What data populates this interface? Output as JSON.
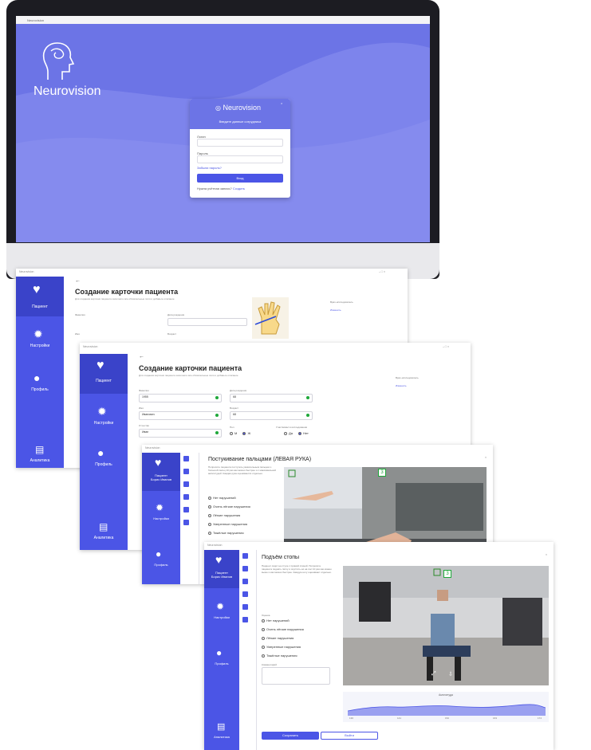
{
  "monitor": {
    "window_title": "Neurovision",
    "brand_name": "Neurovision",
    "login": {
      "logo_text": "Neurovision",
      "heading": "Введите данные сотрудника",
      "login_label": "Логин",
      "password_label": "Пароль",
      "forgot": "Забыли пароль?",
      "submit": "Вход",
      "register_prefix": "Нужна учётная запись?",
      "register_link": "Создать"
    }
  },
  "sidebar": {
    "patient": "Пациент",
    "settings": "Настройки",
    "profile": "Профиль",
    "analytics": "Аналитика"
  },
  "card": {
    "window_title": "Neurovision",
    "back": "←",
    "title": "Создание карточки пациента",
    "subtitle": "Для создания карточки пациента заполните все обязательные поля и добавьте описание",
    "surname_label": "Фамилия",
    "surname_value": "Петров",
    "birth_label": "Дата рождения",
    "birth_value": "1955",
    "name_label": "Имя",
    "name_value": "Иван",
    "age_label": "Возраст",
    "age_value": "68",
    "patronymic_label": "Отчество",
    "patronymic_value": "Иванович",
    "sex_label": "Пол",
    "sex_options": [
      "М",
      "Ж"
    ],
    "extra_label": "Участвовал в исследовании",
    "extra_options": [
      "Да",
      "Нет"
    ],
    "doctor_label": "Врач-исследователь",
    "doctor_value": "Сидоров",
    "change": "Изменить"
  },
  "fingers": {
    "window_title": "Neurovision",
    "title": "Постукивание пальцами (ЛЕВАЯ РУКА)",
    "instruction": "Попросите пациента постучать указательным пальцем о большой палец 10 раз как можно быстрее и с максимальной амплитудой. Каждая рука оценивается отдельно.",
    "options": [
      "Нет нарушений",
      "Очень лёгкие нарушения",
      "Лёгкие нарушения",
      "Умеренные нарушения",
      "Тяжёлые нарушения"
    ],
    "sidebar_item": "Пациент\nБорис Иванов",
    "marker": "3"
  },
  "foot": {
    "window_title": "Neurovision",
    "title": "Подъём стопы",
    "instruction": "Пациент сидит на стуле с прямой спиной. Попросите пациента поднять пятку и опустить её на пол 10 раз как можно выше и как можно быстрее. Каждую ногу оценивают отдельно.",
    "rating_label": "Оценка",
    "options": [
      "Нет нарушений",
      "Очень лёгкие нарушения",
      "Лёгкие нарушения",
      "Умеренные нарушения",
      "Тяжёлые нарушения"
    ],
    "comment_label": "Комментарий",
    "marker": "3",
    "chart_title": "Амплитуда",
    "chart_xticks": [
      "130",
      "141",
      "152",
      "163",
      "174"
    ],
    "save": "Сохранить",
    "exit": "Выйти"
  },
  "colors": {
    "accent": "#4b55e6",
    "screen_bg": "#6c74e6",
    "ok_green": "#1fa83a"
  }
}
